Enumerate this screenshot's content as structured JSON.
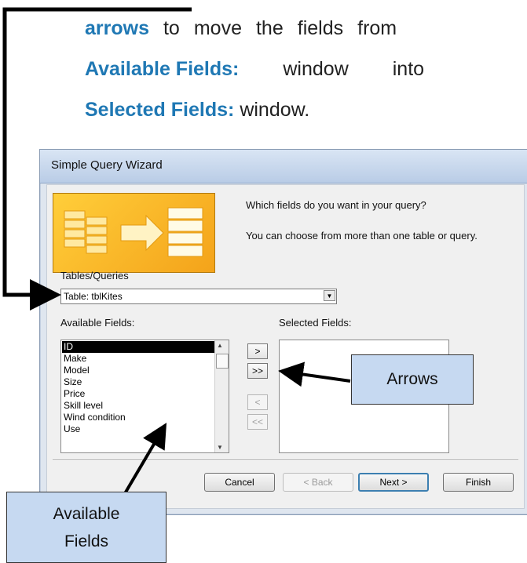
{
  "instructions": {
    "line1_bold": "arrows",
    "line1_a": "to",
    "line1_b": "move",
    "line1_c": "the",
    "line1_d": "fields",
    "line1_e": "from",
    "line2_bold": "Available Fields:",
    "line2_a": "window",
    "line2_b": "into",
    "line3_bold": "Selected Fields:",
    "line3_a": "window."
  },
  "wizard": {
    "title": "Simple Query Wizard",
    "prompt1": "Which fields do you want in your query?",
    "prompt2": "You can choose from more than one table or query.",
    "tables_label": "Tables/Queries",
    "tables_value": "Table: tblKites",
    "available_label": "Available Fields:",
    "selected_label": "Selected Fields:",
    "available_fields": [
      "ID",
      "Make",
      "Model",
      "Size",
      "Price",
      "Skill level",
      "Wind condition",
      "Use"
    ],
    "selected_index": 0,
    "selected_fields": [],
    "move_buttons": [
      ">",
      ">>",
      "<",
      "<<"
    ],
    "buttons": {
      "cancel": "Cancel",
      "back": "< Back",
      "next": "Next >",
      "finish": "Finish"
    }
  },
  "callouts": {
    "arrows": "Arrows",
    "available": [
      "Available",
      "Fields"
    ]
  },
  "colors": {
    "accent_text": "#1f78b4",
    "callout_fill": "#c6d9f1",
    "banner_fill": "#f4a31a"
  }
}
